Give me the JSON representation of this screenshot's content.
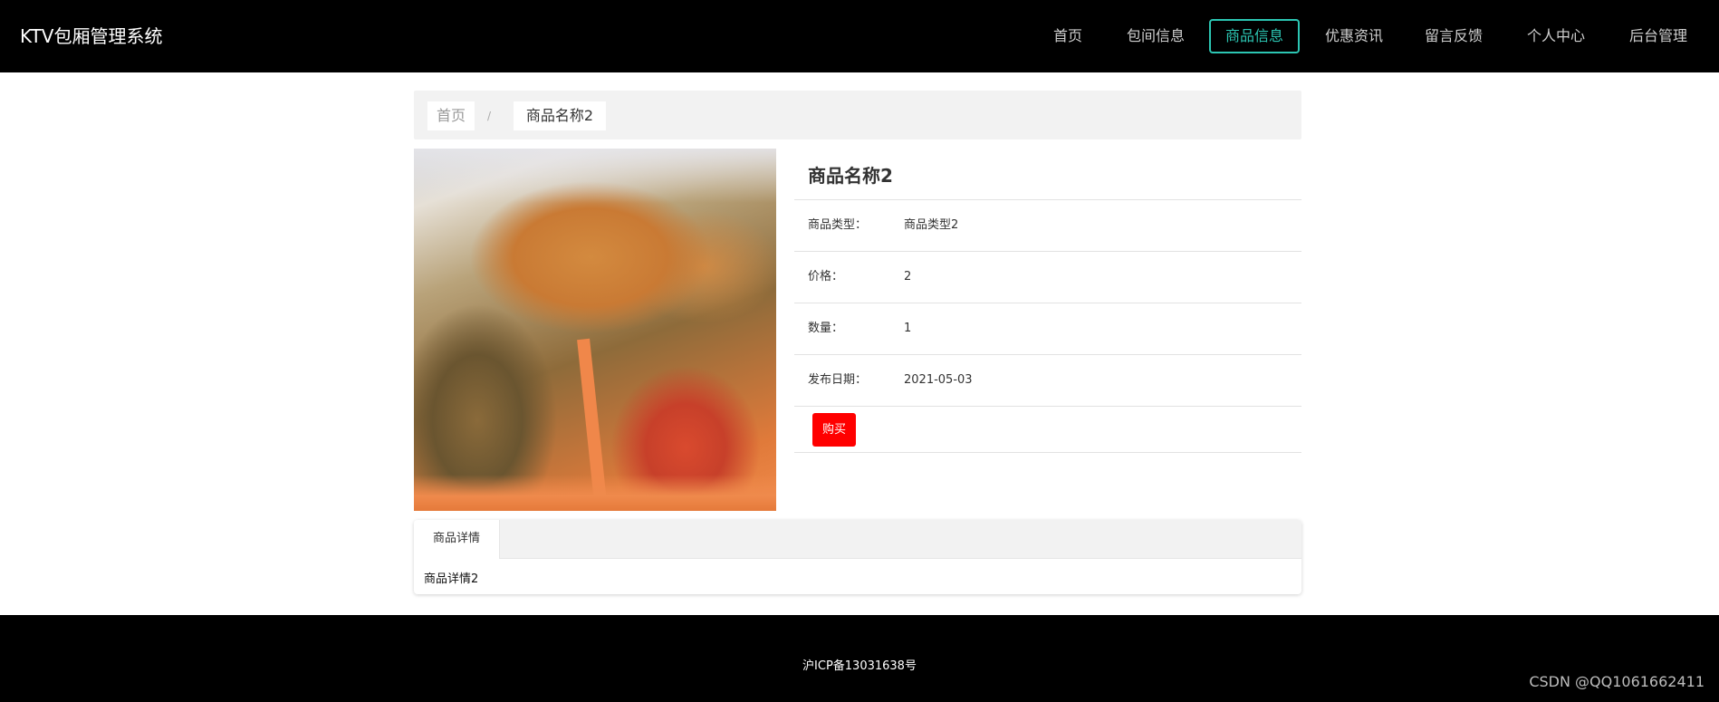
{
  "header": {
    "brand": "KTV包厢管理系统",
    "nav": [
      {
        "label": "首页",
        "active": false
      },
      {
        "label": "包间信息",
        "active": false
      },
      {
        "label": "商品信息",
        "active": true
      },
      {
        "label": "优惠资讯",
        "active": false
      },
      {
        "label": "留言反馈",
        "active": false
      },
      {
        "label": "个人中心",
        "active": false
      },
      {
        "label": "后台管理",
        "active": false
      }
    ]
  },
  "breadcrumb": {
    "home": "首页",
    "separator": "/",
    "current": "商品名称2"
  },
  "product": {
    "image_icon": "product-photo",
    "title": "商品名称2",
    "fields": [
      {
        "label": "商品类型：",
        "value": "商品类型2"
      },
      {
        "label": "价格：",
        "value": "2"
      },
      {
        "label": "数量：",
        "value": "1"
      },
      {
        "label": "发布日期：",
        "value": "2021-05-03"
      }
    ],
    "buy_label": "购买"
  },
  "tabs": {
    "items": [
      {
        "label": "商品详情"
      }
    ],
    "content": "商品详情2"
  },
  "footer": {
    "icp": "沪ICP备13031638号",
    "watermark": "CSDN @QQ1061662411"
  },
  "colors": {
    "header_bg": "#000000",
    "active_nav": "#2cc6b3",
    "buy_button": "#ff0000"
  }
}
